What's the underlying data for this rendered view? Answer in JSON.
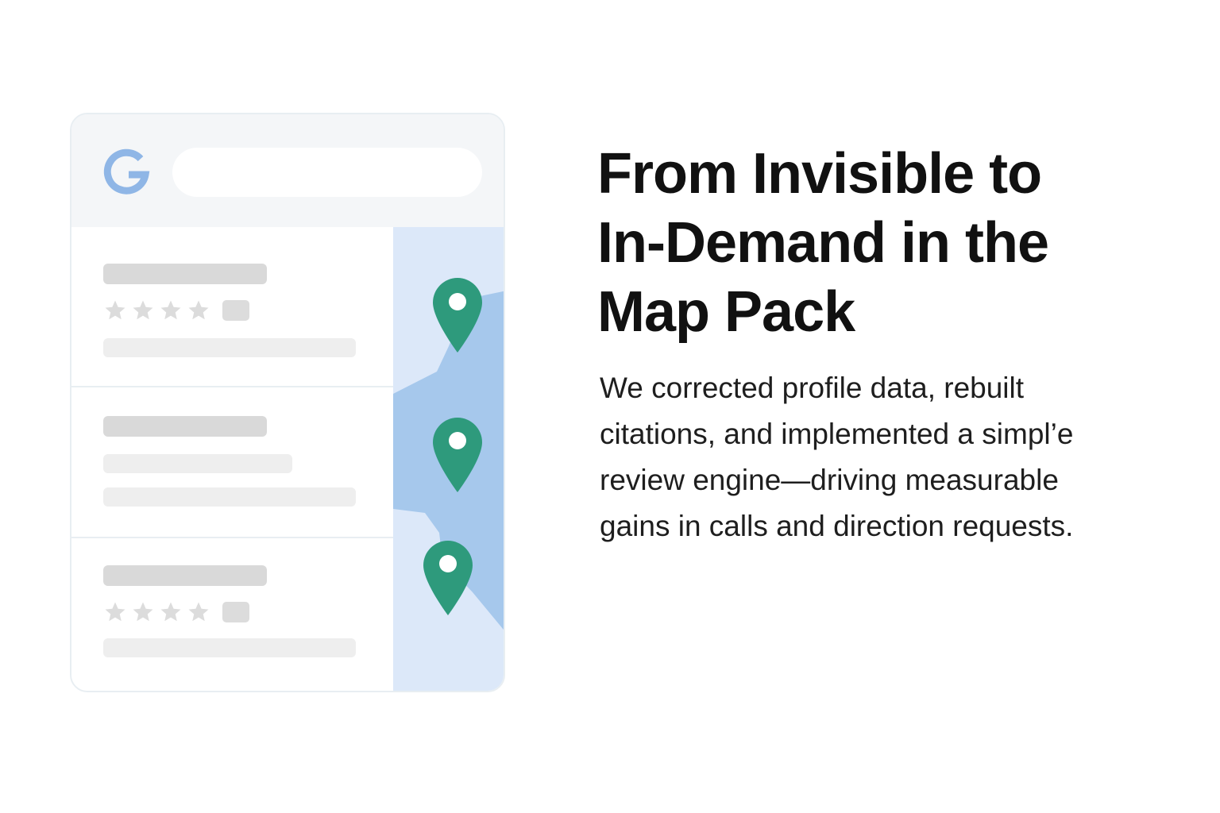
{
  "card": {
    "logo_icon": "google-g-icon",
    "search_placeholder": "",
    "results": [
      {
        "has_rating_stars": true,
        "star_count": 4
      },
      {
        "has_rating_stars": false
      },
      {
        "has_rating_stars": true,
        "star_count": 4
      }
    ],
    "map_pins": 3,
    "pin_icon": "map-pin-icon",
    "star_icon": "star-icon"
  },
  "colors": {
    "logo_blue": "#8fb6e6",
    "pin_green": "#2e9a7c",
    "map_light": "#dce8f9",
    "map_water": "#a6c8ec",
    "placeholder_dark": "#d9d9d9",
    "placeholder_light": "#eeeeee"
  },
  "headline": {
    "lines": [
      "From Invisible to",
      "In-Demand in the",
      "Map Pack"
    ]
  },
  "body": {
    "lines": [
      "We corrected profile data, rebuilt",
      "citations, and implemented a simpl’e",
      "review engine—driving measurable",
      "gains in calls and direction requests."
    ]
  }
}
